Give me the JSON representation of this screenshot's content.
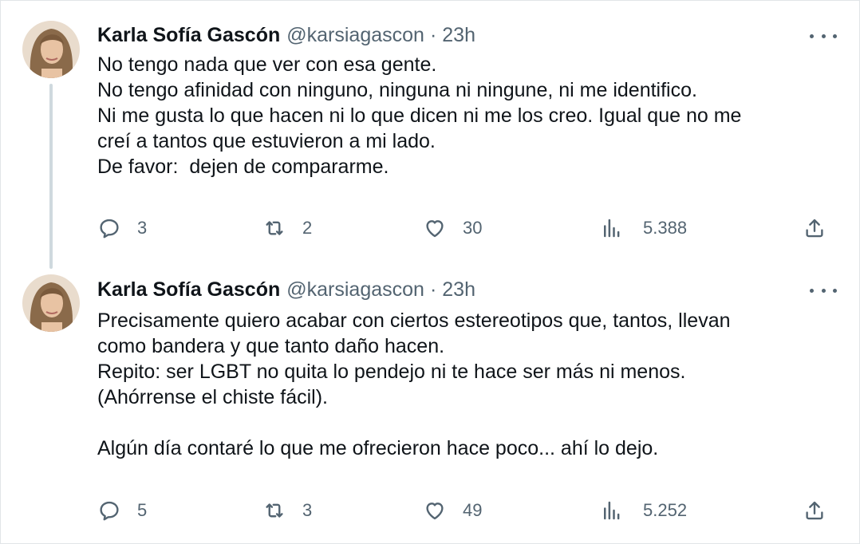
{
  "colors": {
    "text_primary": "#0f1419",
    "text_secondary": "#536471",
    "thread_line": "#cfd9de",
    "background": "#ffffff"
  },
  "tweets": [
    {
      "author_name": "Karla Sofía Gascón",
      "handle": "@karsiagascon",
      "separator": "·",
      "time": "23h",
      "lines": [
        "No tengo nada que ver con esa gente.",
        "No tengo afinidad con ninguno, ninguna ni ningune, ni me identifico.",
        "Ni me gusta lo que hacen ni lo que dicen ni me los creo. Igual que no me",
        "creí a tantos que estuvieron a mi lado.",
        "De favor:  dejen de compararme."
      ],
      "replies": "3",
      "retweets": "2",
      "likes": "30",
      "views": "5.388"
    },
    {
      "author_name": "Karla Sofía Gascón",
      "handle": "@karsiagascon",
      "separator": "·",
      "time": "23h",
      "lines": [
        "Precisamente quiero acabar con ciertos estereotipos que, tantos, llevan",
        "como bandera y que tanto daño hacen.",
        "Repito: ser LGBT no quita lo pendejo ni te hace ser más ni menos.",
        "(Ahórrense el chiste fácil).",
        "",
        "Algún día contaré lo que me ofrecieron hace poco... ahí lo dejo."
      ],
      "replies": "5",
      "retweets": "3",
      "likes": "49",
      "views": "5.252"
    }
  ],
  "icons": {
    "reply": "reply-icon",
    "retweet": "retweet-icon",
    "like": "heart-icon",
    "views": "views-icon",
    "share": "share-icon",
    "more": "more-icon"
  }
}
